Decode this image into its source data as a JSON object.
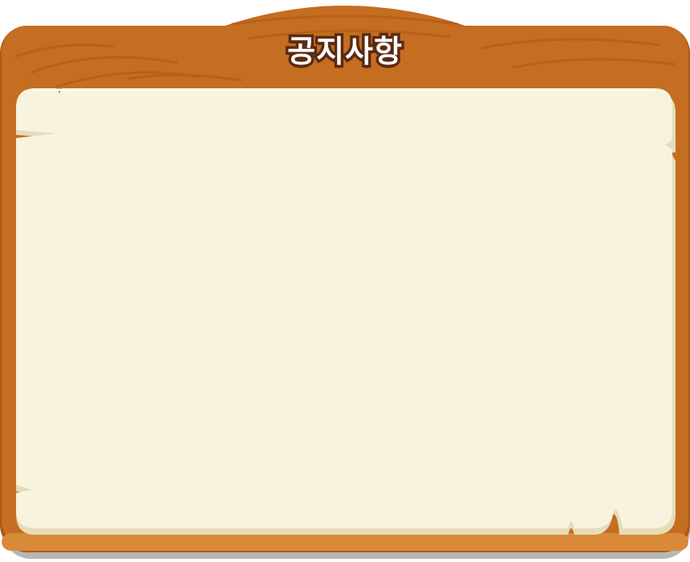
{
  "panel": {
    "title": "공지사항"
  },
  "colors": {
    "wood": "#c56d21",
    "wood_dark": "#a65614",
    "wood_edge": "#8a4410",
    "paper": "#f8f3dd",
    "paper_shadow": "#e2d8b6",
    "title_outline": "#5b2a12"
  }
}
